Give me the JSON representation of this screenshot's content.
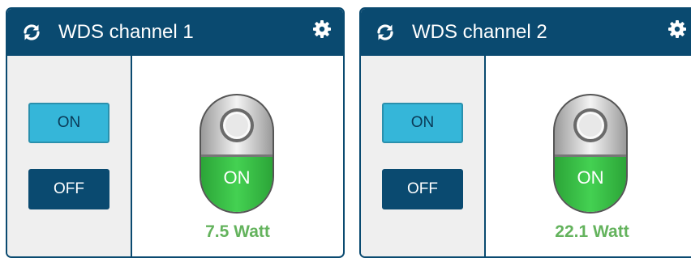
{
  "channels": [
    {
      "title": "WDS channel 1",
      "on_label": "ON",
      "off_label": "OFF",
      "switch_state": "ON",
      "power": "7.5 Watt"
    },
    {
      "title": "WDS channel 2",
      "on_label": "ON",
      "off_label": "OFF",
      "switch_state": "ON",
      "power": "22.1 Watt"
    }
  ],
  "icons": {
    "refresh": "refresh-icon",
    "settings": "gear-icon"
  },
  "colors": {
    "header": "#0a4a70",
    "on_button": "#35b6d9",
    "off_button": "#0a4a70",
    "switch_on": "#3cc44a",
    "power_text": "#64b35d"
  }
}
